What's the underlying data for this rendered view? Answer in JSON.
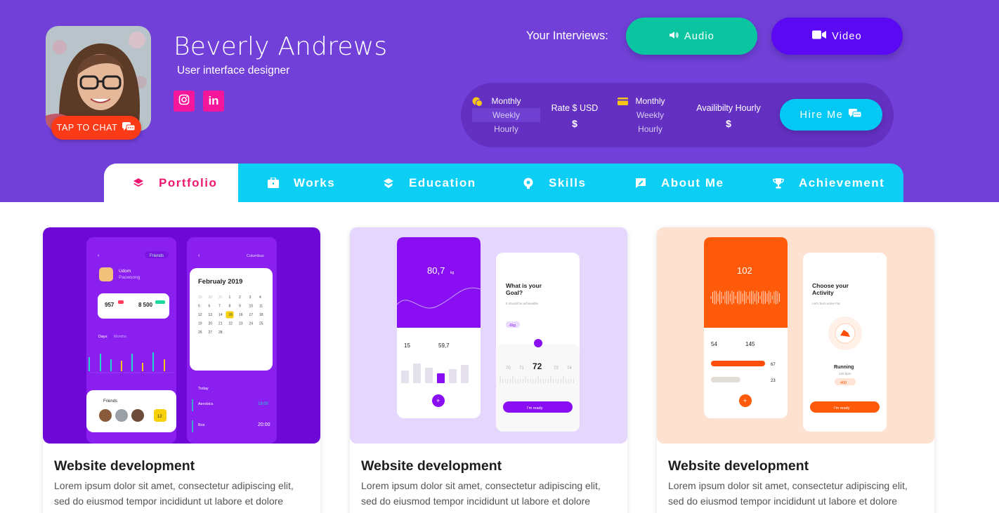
{
  "profile": {
    "name": "Beverly Andrews",
    "role": "User interface designer",
    "chat_label": "TAP TO CHAT"
  },
  "social": [
    {
      "icon": "instagram-icon"
    },
    {
      "icon": "linkedin-icon",
      "label": "in"
    }
  ],
  "interviews": {
    "label": "Your Interviews:",
    "audio_label": "Audio",
    "video_label": "Video"
  },
  "rates": {
    "period1": {
      "options": [
        "Monthly",
        "Weekly",
        "Hourly"
      ],
      "icon": "coins-icon"
    },
    "rate_label": "Rate $ USD",
    "rate_value": "$",
    "period2": {
      "options": [
        "Monthly",
        "Weekly",
        "Hourly"
      ],
      "icon": "card-icon"
    },
    "avail_label": "Availibilty Hourly",
    "avail_value": "$",
    "hire_label": "Hire Me"
  },
  "tabs": [
    {
      "label": "Portfolio",
      "icon": "layers-icon",
      "active": true
    },
    {
      "label": "Works",
      "icon": "briefcase-icon"
    },
    {
      "label": "Education",
      "icon": "education-icon"
    },
    {
      "label": "Skills",
      "icon": "skills-icon"
    },
    {
      "label": "About Me",
      "icon": "about-icon"
    },
    {
      "label": "Achievement",
      "icon": "trophy-icon"
    }
  ],
  "cards": [
    {
      "title": "Website development",
      "desc": "Lorem ipsum dolor sit amet, consectetur adipiscing elit, sed do eiusmod tempor incididunt ut labore et dolore"
    },
    {
      "title": "Website development",
      "desc": "Lorem ipsum dolor sit amet, consectetur adipiscing elit, sed do eiusmod tempor incididunt ut labore et dolore"
    },
    {
      "title": "Website development",
      "desc": "Lorem ipsum dolor sit amet, consectetur adipiscing elit, sed do eiusmod tempor incididunt ut labore et dolore"
    }
  ],
  "mockups": {
    "card1": {
      "user_name": "Udom",
      "user_sub": "Paowsong",
      "badge": "Friends",
      "location": "Columbus",
      "stat1": "957",
      "stat2": "8 500",
      "tab1": "Days",
      "tab2": "Months",
      "calendar_title": "Februaly 2019",
      "cal_days": [
        "29",
        "30",
        "31",
        "1",
        "2",
        "3",
        "4",
        "5",
        "6",
        "7",
        "8",
        "9",
        "10",
        "11",
        "12",
        "13",
        "14",
        "15",
        "16",
        "17",
        "18",
        "19",
        "20",
        "21",
        "22",
        "23",
        "24",
        "25",
        "26",
        "27",
        "28"
      ],
      "cal_selected": "15",
      "friends_label": "Friends",
      "friends_count": "12",
      "today_label": "Today",
      "event1": "Aerobics",
      "event1_time": "19:00",
      "event2": "Box",
      "event2_time": "20:00"
    },
    "card2": {
      "weight": "80,7",
      "weight_unit": "kg",
      "stat1": "15",
      "stat2": "59,7",
      "goal_title": "What is your Goal?",
      "goal_sub": "It should be achievable",
      "goal_chip": "-6kg",
      "ruler_value": "72",
      "ruler_prev": "71",
      "ruler_prev2": "70",
      "ruler_next": "73",
      "ruler_next2": "74",
      "cta": "I'm ready"
    },
    "card3": {
      "heart_value": "102",
      "stat1": "54",
      "stat2": "145",
      "pct1": "67",
      "pct2": "23",
      "activity_title": "Choose your Activity",
      "activity_sub": "Let's burn some Fat",
      "running": "Running",
      "running_sub": "120 bpm",
      "running_chip": "400",
      "cta": "I'm ready"
    }
  },
  "colors": {
    "header_bg": "#7040d8",
    "tab_bar": "#0dcef4",
    "tab_active_text": "#f0166f",
    "audio": "#0ac5a0",
    "video": "#5b08f3",
    "hire": "#03c8f4",
    "chat": "#fb3b17",
    "social": "#f5169a"
  }
}
